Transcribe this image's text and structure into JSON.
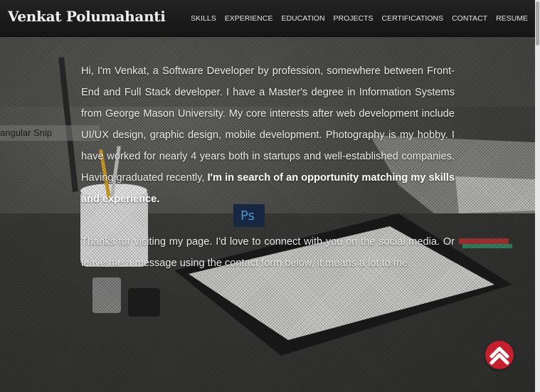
{
  "header": {
    "brand": "Venkat Polumahanti",
    "nav": [
      "SKILLS",
      "EXPERIENCE",
      "EDUCATION",
      "PROJECTS",
      "CERTIFICATIONS",
      "CONTACT",
      "RESUME"
    ]
  },
  "overlay": {
    "snip_label": "angular Snip"
  },
  "about": {
    "intro": "Hi, I'm Venkat, a Software Developer by profession, somewhere between Front-End and Full Stack developer. I have a Master's degree in Information Systems from George Mason University. My core interests after web development include UI/UX design, graphic design, mobile development. Photography is my hobby. I have worked for nearly 4 years both in startups and well-established companies. Having graduated recently, ",
    "intro_bold": "I'm in search of an opportunity matching my skills and experience.",
    "thanks": "Thanks for visiting my page. I'd love to connect with you on the social media. Or leave me a message using the contact form below, it means a lot to me."
  },
  "photo": {
    "ps_label": "Ps"
  },
  "colors": {
    "navbar": "#1a1a1a",
    "accent": "#c61f2e",
    "text": "#e9e9e9"
  },
  "icons": {
    "back_to_top": "chevron-up-icon"
  }
}
